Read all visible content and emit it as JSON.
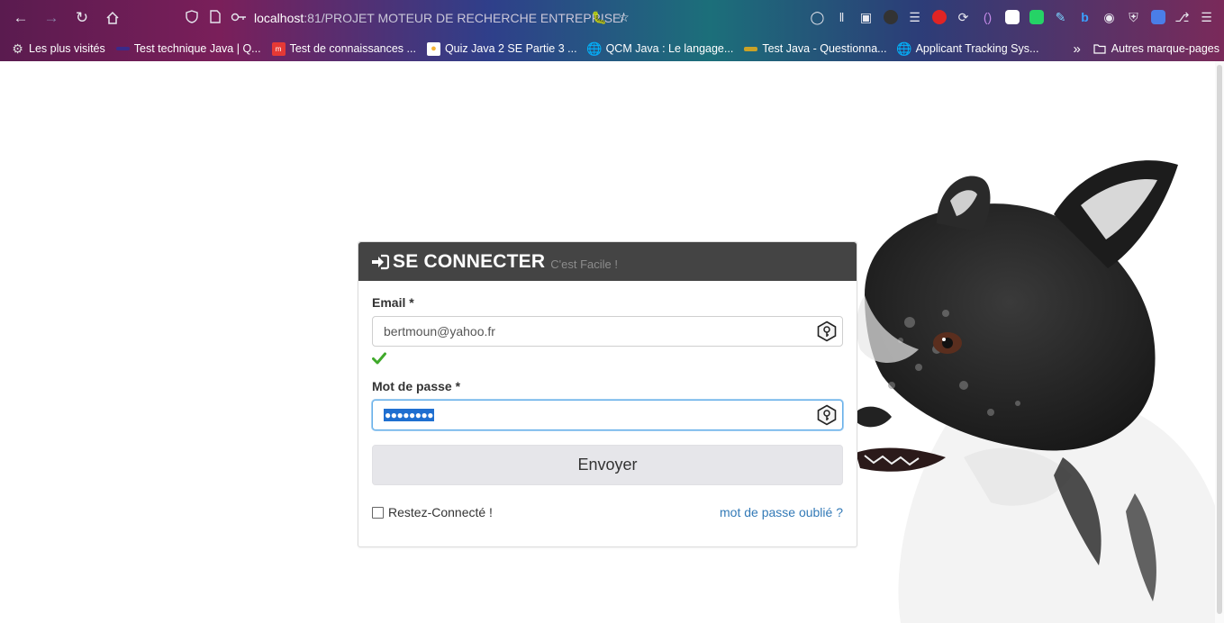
{
  "browser": {
    "url_host": "localhost",
    "url_path": ":81/PROJET MOTEUR DE RECHERCHE ENTREPRISE/",
    "bookmarks": [
      {
        "label": "Les plus visités",
        "icon": "gear-icon",
        "color": "#dddddd"
      },
      {
        "label": "Test technique Java | Q...",
        "icon": "bookmark-icon",
        "color": "#3a2a8a"
      },
      {
        "label": "Test de connaissances ...",
        "icon": "mfl-icon",
        "color": "#e53935"
      },
      {
        "label": "Quiz Java 2 SE Partie 3 ...",
        "icon": "quiz-icon",
        "color": "#f5b335"
      },
      {
        "label": "QCM Java : Le langage...",
        "icon": "globe-icon",
        "color": "#dddddd"
      },
      {
        "label": "Test Java - Questionna...",
        "icon": "test-icon",
        "color": "#c9a227"
      },
      {
        "label": "Applicant Tracking Sys...",
        "icon": "globe-icon",
        "color": "#dddddd"
      }
    ],
    "other_bookmarks": "Autres marque-pages"
  },
  "login": {
    "title": "SE CONNECTER",
    "subtitle": "C'est Facile !",
    "email_label": "Email *",
    "email_value": "bertmoun@yahoo.fr",
    "password_label": "Mot de passe *",
    "password_value": "●●●●●●●●",
    "submit_label": "Envoyer",
    "remember_label": "Restez-Connecté !",
    "forgot_label": "mot de passe oublié ?"
  },
  "colors": {
    "header_bg": "#444444",
    "link": "#337ab7",
    "check": "#3fa92a",
    "focus": "#66afe9"
  }
}
